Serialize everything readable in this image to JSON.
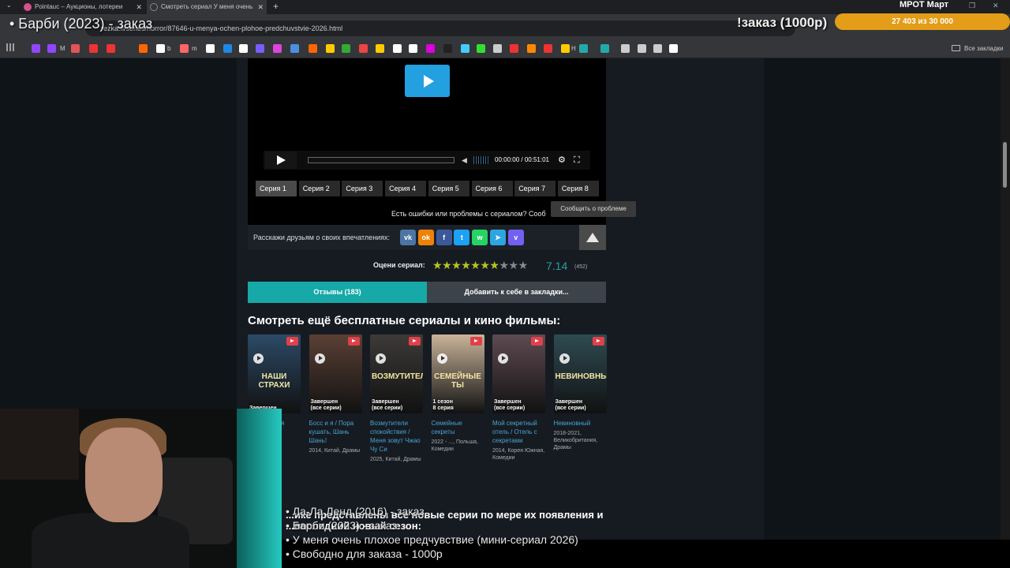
{
  "browser": {
    "tabs": [
      {
        "label": "Pointauc – Аукционы, лотереи",
        "active": false
      },
      {
        "label": "Смотреть сериал У меня очень",
        "active": true
      }
    ],
    "new_tab": "+",
    "url": "rezka.fi/series/horror/87646-u-menya-ochen-plohoe-predchuvstvie-2026.html",
    "bookmarks_all": "Все закладки",
    "bookmark_letters": [
      "M",
      "b",
      "m",
      "H"
    ]
  },
  "player": {
    "time_current": "00:00:00",
    "time_separator": "/",
    "time_total": "00:51:01",
    "episodes": [
      "Серия 1",
      "Серия 2",
      "Серия 3",
      "Серия 4",
      "Серия 5",
      "Серия 6",
      "Серия 7",
      "Серия 8"
    ],
    "active_episode": 0
  },
  "errors_text": "Есть ошибки или проблемы с сериалом? Сооб",
  "tooltip": "Сообщить о проблеме",
  "share": {
    "label": "Расскажи друзьям о своих впечатлениях:",
    "icons": [
      {
        "name": "vk-icon",
        "glyph": "vk",
        "color": "#4c75a3"
      },
      {
        "name": "odnoklassniki-icon",
        "glyph": "ok",
        "color": "#ee8208"
      },
      {
        "name": "facebook-icon",
        "glyph": "f",
        "color": "#3b5998"
      },
      {
        "name": "twitter-icon",
        "glyph": "t",
        "color": "#1da1f2"
      },
      {
        "name": "whatsapp-icon",
        "glyph": "w",
        "color": "#25d366"
      },
      {
        "name": "telegram-icon",
        "glyph": "➤",
        "color": "#2ca5e0"
      },
      {
        "name": "viber-icon",
        "glyph": "v",
        "color": "#7360f2"
      }
    ]
  },
  "rating": {
    "label": "Оцени сериал:",
    "value": "7.14",
    "count": "(452)",
    "stars_total": 10,
    "stars_filled": 7
  },
  "buttons": {
    "reviews": "Отзывы (183)",
    "bookmark": "Добавить к себе в закладки..."
  },
  "section_heading": "Смотреть ещё бесплатные сериалы и кино фильмы:",
  "cards": [
    {
      "status": "Завершен",
      "poster_text": "НАШИ СТРАХИ",
      "name": "...ки / ...имся",
      "meta": "...кия,",
      "bg": "#2c4a66"
    },
    {
      "status": "Завершен\n(все серии)",
      "poster_text": "",
      "name": "Босс и я / Пора кушать, Шань Шань!",
      "meta": "2014, Китай, Драмы",
      "bg": "#5a4035"
    },
    {
      "status": "Завершен\n(все серии)",
      "poster_text": "ВОЗМУТИТЕЛИ",
      "name": "Возмутители спокойствия / Меня зовут Чжао Чу Си",
      "meta": "2025, Китай, Драмы",
      "bg": "#3d3a38"
    },
    {
      "status": "1 сезон\n8 серия",
      "poster_text": "СЕМЕЙНЫЕ ТЫ",
      "name": "Семейные секреты",
      "meta": "2022 - ..., Польша, Комедии",
      "bg": "#c9b49a"
    },
    {
      "status": "Завершен\n(все серии)",
      "poster_text": "",
      "name": "Мой секретный отель / Отель с секретами",
      "meta": "2014, Корея Южная, Комедии",
      "bg": "#5e4a52"
    },
    {
      "status": "Завершен\n(все серии)",
      "poster_text": "НЕВИНОВНЫЙ",
      "name": "Невиновный",
      "meta": "2018-2021, Великобритания, Драмы",
      "bg": "#2e4b52"
    }
  ],
  "partial_text": "...ике представлены все новые серии по мере их появления и\n...последний новый сезон:",
  "stream_overlay": {
    "title": "• Барби (2023) - заказ",
    "order": "!заказ (1000р)",
    "mrot": "МРОТ Март",
    "goal": "27 403  из 30 000",
    "list": [
      "• Ла-Ла Ленд (2016) - заказ",
      "• Барби (2023) - заказ",
      "• У меня очень плохое предчувствие (мини-сериал 2026)",
      "• Свободно для заказа - 1000р"
    ]
  }
}
